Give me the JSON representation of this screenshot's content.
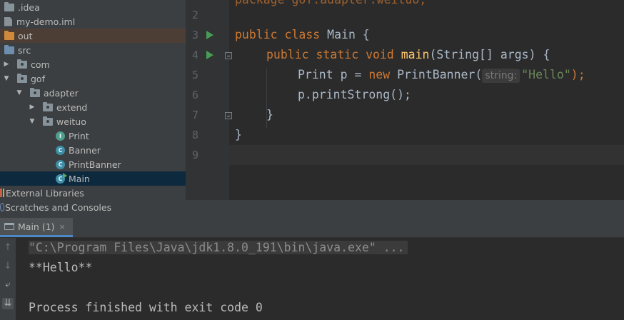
{
  "project_tree": {
    "items": [
      {
        "label": ".idea"
      },
      {
        "label": "my-demo.iml"
      },
      {
        "label": "out"
      },
      {
        "label": "src"
      },
      {
        "label": "com"
      },
      {
        "label": "gof"
      },
      {
        "label": "adapter"
      },
      {
        "label": "extend"
      },
      {
        "label": "weituo"
      },
      {
        "label": "Print",
        "icon_letter": "I"
      },
      {
        "label": "Banner",
        "icon_letter": "C"
      },
      {
        "label": "PrintBanner",
        "icon_letter": "C"
      },
      {
        "label": "Main",
        "icon_letter": "C"
      },
      {
        "label": "External Libraries"
      },
      {
        "label": "Scratches and Consoles"
      }
    ]
  },
  "editor": {
    "line_numbers": [
      "2",
      "3",
      "4",
      "5",
      "6",
      "7",
      "8",
      "9"
    ],
    "code": {
      "l3_kw": "public class ",
      "l3_rest": "Main {",
      "l4_kw1": "public static void ",
      "l4_fn": "main",
      "l4_rest": "(String[] args) {",
      "l5_a": "Print p = ",
      "l5_kw": "new ",
      "l5_b": "PrintBanner(",
      "l5_hint": "string:",
      "l5_str": "\"Hello\"",
      "l5_end": ");",
      "l6": "p.printStrong();",
      "l7": "}",
      "l8": "}"
    }
  },
  "run_panel": {
    "tab_label": "Main (1)",
    "tab_close": "×",
    "console": {
      "command": "\"C:\\Program Files\\Java\\jdk1.8.0_191\\bin\\java.exe\" ...",
      "output": "**Hello**",
      "exit": "Process finished with exit code 0"
    }
  },
  "colors": {
    "keyword": "#cc7832",
    "method": "#ffc66d",
    "string": "#6a8759",
    "selection": "#0d293e"
  }
}
